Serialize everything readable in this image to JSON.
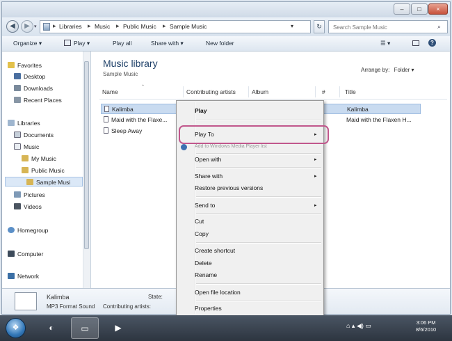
{
  "window": {
    "controls": {
      "minimize": "–",
      "maximize": "□",
      "close": "×"
    }
  },
  "address": {
    "icon": "music-library-icon",
    "crumbs": [
      "Libraries",
      "Music",
      "Public Music",
      "Sample Music"
    ],
    "separator": "▸",
    "search_placeholder": "Search Sample Music"
  },
  "toolbar": {
    "organize": "Organize ▾",
    "play": "Play ▾",
    "play_all": "Play all",
    "share_with": "Share with ▾",
    "new_folder": "New folder"
  },
  "nav": {
    "favorites": "Favorites",
    "desktop": "Desktop",
    "downloads": "Downloads",
    "recent": "Recent Places",
    "libraries": "Libraries",
    "documents": "Documents",
    "music": "Music",
    "my_music": "My Music",
    "public_music": "Public Music",
    "sample_music": "Sample Musi",
    "pictures": "Pictures",
    "videos": "Videos",
    "homegroup": "Homegroup",
    "computer": "Computer",
    "network": "Network"
  },
  "main": {
    "title": "Music library",
    "subtitle": "Sample Music",
    "arrange_label": "Arrange by:",
    "arrange_value": "Folder ▾",
    "columns": [
      "Name",
      "Contributing artists",
      "Album",
      "#",
      "Title"
    ],
    "rows": [
      {
        "name": "Kalimba",
        "title": "Kalimba"
      },
      {
        "name": "Maid with the Flaxe...",
        "title": "Maid with the Flaxen H..."
      },
      {
        "name": "Sleep Away",
        "title": ""
      }
    ]
  },
  "details": {
    "name": "Kalimba",
    "type": "MP3 Format Sound",
    "state_label": "State:",
    "artists_label": "Contributing artists:"
  },
  "context_menu": {
    "play": "Play",
    "play_to": "Play To",
    "add_list": "Add to Windows Media Player list",
    "open_with": "Open with",
    "share_with": "Share with",
    "restore": "Restore previous versions",
    "send_to": "Send to",
    "cut": "Cut",
    "copy": "Copy",
    "create_shortcut": "Create shortcut",
    "delete": "Delete",
    "rename": "Rename",
    "open_location": "Open file location",
    "properties": "Properties",
    "submenu_arrow": "▸"
  },
  "taskbar": {
    "start": "❖",
    "tray_icons": "⌂ ▴ ◀) ▭",
    "time": "3:06 PM",
    "date": "8/6/2010"
  }
}
